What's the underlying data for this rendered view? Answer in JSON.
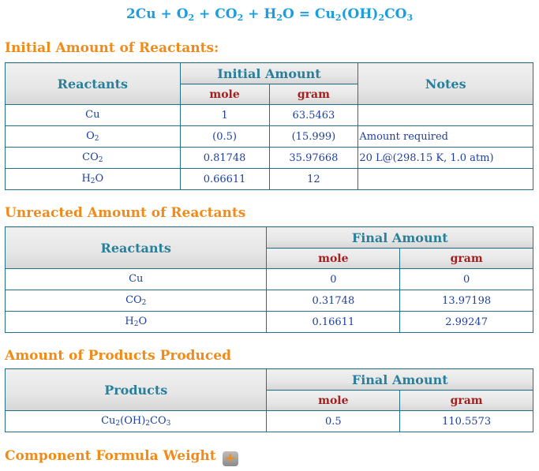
{
  "equation": {
    "parts": [
      "2Cu + O",
      "2",
      " + CO",
      "2",
      " + H",
      "2",
      "O = Cu",
      "2",
      "(OH)",
      "2",
      "CO",
      "3"
    ]
  },
  "initial": {
    "title": "Initial Amount of Reactants:",
    "headers": {
      "reactants": "Reactants",
      "group": "Initial Amount",
      "mole": "mole",
      "gram": "gram",
      "notes": "Notes"
    },
    "rows": [
      {
        "name_base": "Cu",
        "name_sub": "",
        "name_tail": "",
        "mole": "1",
        "gram": "63.5463",
        "note": ""
      },
      {
        "name_base": "O",
        "name_sub": "2",
        "name_tail": "",
        "mole": "(0.5)",
        "gram": "(15.999)",
        "note": "Amount required"
      },
      {
        "name_base": "CO",
        "name_sub": "2",
        "name_tail": "",
        "mole": "0.81748",
        "gram": "35.97668",
        "note": "20 L@(298.15 K, 1.0 atm)"
      },
      {
        "name_base": "H",
        "name_sub": "2",
        "name_tail": "O",
        "mole": "0.66611",
        "gram": "12",
        "note": ""
      }
    ]
  },
  "unreacted": {
    "title": "Unreacted Amount of Reactants",
    "headers": {
      "reactants": "Reactants",
      "group": "Final Amount",
      "mole": "mole",
      "gram": "gram"
    },
    "rows": [
      {
        "name_base": "Cu",
        "name_sub": "",
        "name_tail": "",
        "mole": "0",
        "gram": "0"
      },
      {
        "name_base": "CO",
        "name_sub": "2",
        "name_tail": "",
        "mole": "0.31748",
        "gram": "13.97198"
      },
      {
        "name_base": "H",
        "name_sub": "2",
        "name_tail": "O",
        "mole": "0.16611",
        "gram": "2.99247"
      }
    ]
  },
  "products": {
    "title": "Amount of Products Produced",
    "headers": {
      "products": "Products",
      "group": "Final Amount",
      "mole": "mole",
      "gram": "gram"
    },
    "rows": [
      {
        "parts": [
          "Cu",
          "2",
          "(OH)",
          "2",
          "CO",
          "3"
        ],
        "mole": "0.5",
        "gram": "110.5573"
      }
    ]
  },
  "component": {
    "title": "Component Formula Weight",
    "expand_label": "+",
    "expand_icon": "plus-icon"
  },
  "colors": {
    "equation": "#1b9ee0",
    "section_title": "#f28a17",
    "header_main": "#2a7f9b",
    "header_sub": "#a32020",
    "cell_text": "#1f3f9a",
    "border": "#23708c"
  }
}
